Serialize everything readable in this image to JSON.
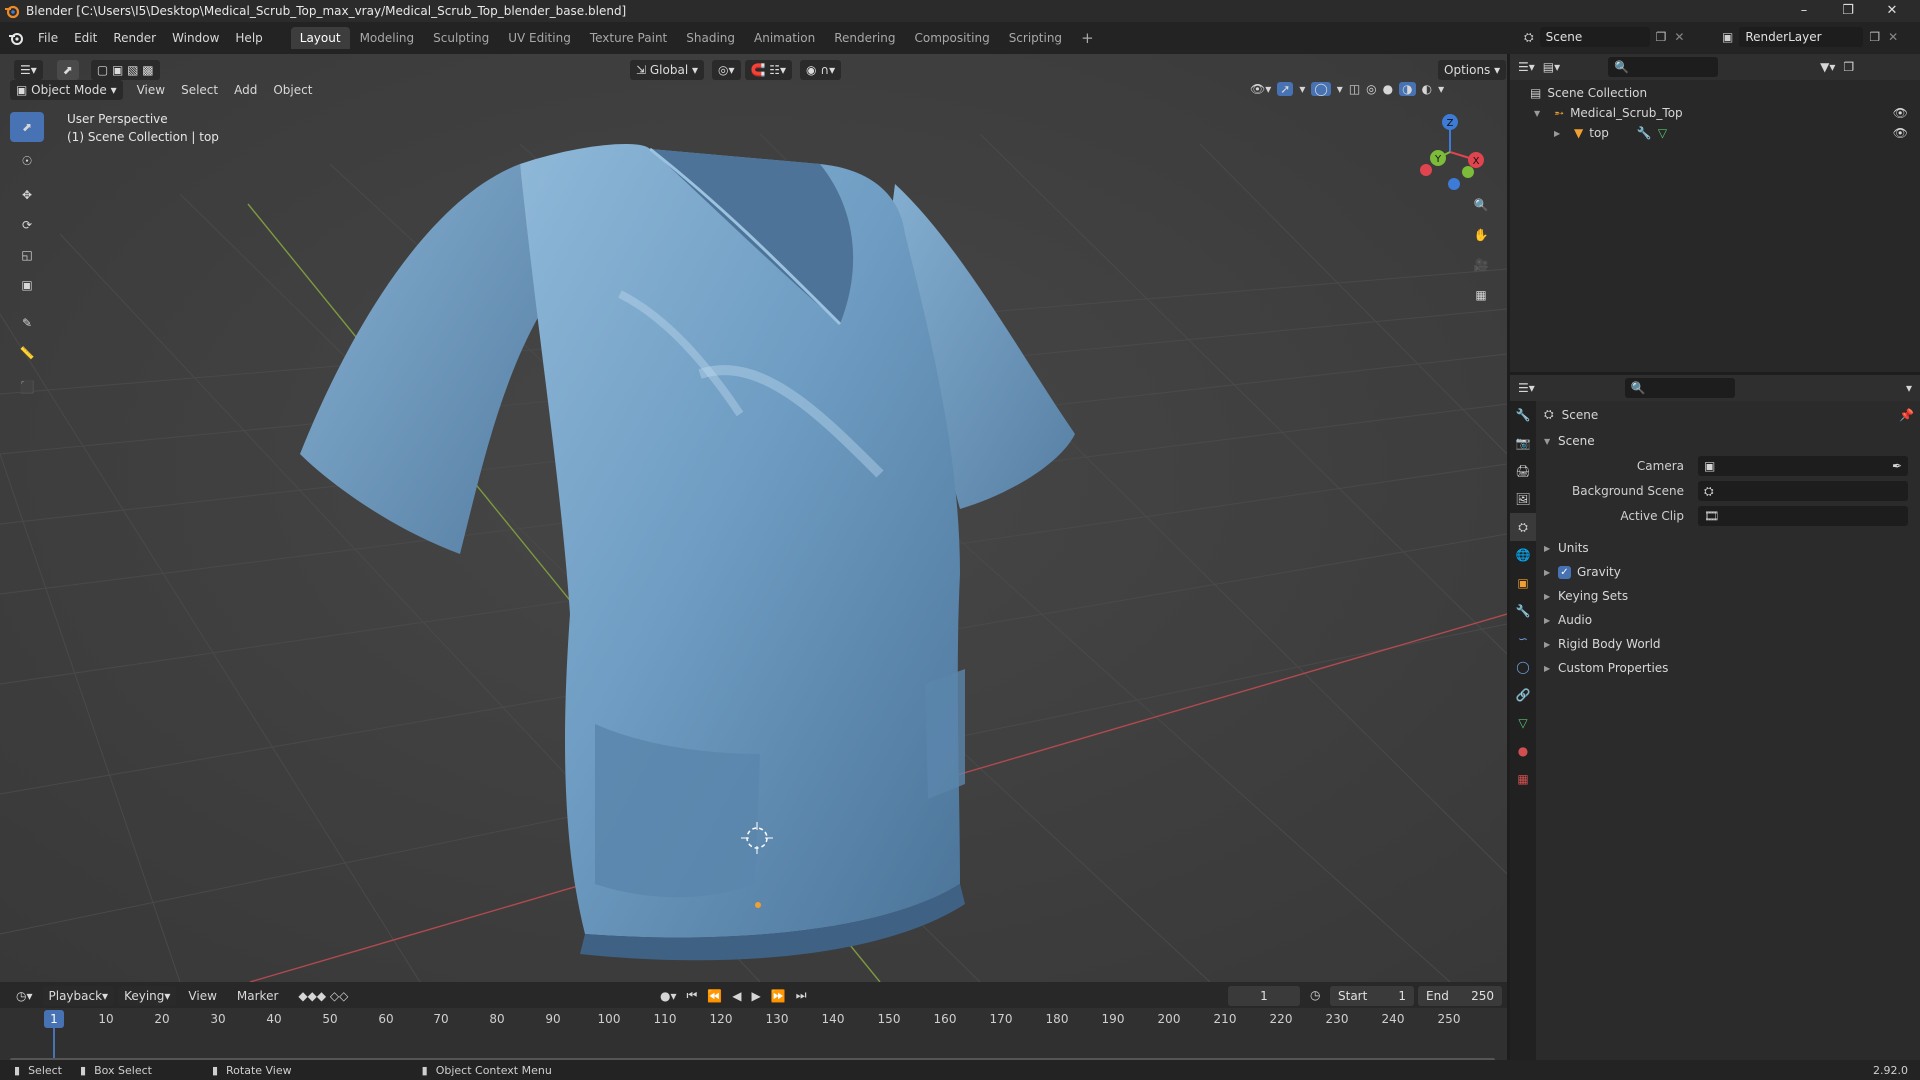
{
  "window": {
    "title": "Blender [C:\\Users\\I5\\Desktop\\Medical_Scrub_Top_max_vray/Medical_Scrub_Top_blender_base.blend]"
  },
  "menu": [
    "File",
    "Edit",
    "Render",
    "Window",
    "Help"
  ],
  "workspaces": [
    "Layout",
    "Modeling",
    "Sculpting",
    "UV Editing",
    "Texture Paint",
    "Shading",
    "Animation",
    "Rendering",
    "Compositing",
    "Scripting"
  ],
  "active_workspace": "Layout",
  "scene_field": "Scene",
  "renderlayer_field": "RenderLayer",
  "viewport": {
    "mode": "Object Mode",
    "menus": [
      "View",
      "Select",
      "Add",
      "Object"
    ],
    "transform_orientation": "Global",
    "options_label": "Options",
    "overlay_line1": "User Perspective",
    "overlay_line2": "(1) Scene Collection | top",
    "gizmo_axes": {
      "x": "X",
      "y": "Y",
      "z": "Z"
    }
  },
  "outliner": {
    "root": "Scene Collection",
    "items": [
      {
        "label": "Medical_Scrub_Top"
      },
      {
        "label": "top"
      }
    ]
  },
  "properties": {
    "header": "Scene",
    "section": "Scene",
    "fields": [
      {
        "label": "Camera"
      },
      {
        "label": "Background Scene"
      },
      {
        "label": "Active Clip"
      }
    ],
    "panels": [
      "Units",
      "Gravity",
      "Keying Sets",
      "Audio",
      "Rigid Body World",
      "Custom Properties"
    ],
    "gravity_checked": true
  },
  "timeline": {
    "menus": [
      "Playback",
      "Keying",
      "View",
      "Marker"
    ],
    "current_frame": "1",
    "start_label": "Start",
    "start_value": "1",
    "end_label": "End",
    "end_value": "250",
    "ruler": [
      "1",
      "10",
      "20",
      "30",
      "40",
      "50",
      "60",
      "70",
      "80",
      "90",
      "100",
      "110",
      "120",
      "130",
      "140",
      "150",
      "160",
      "170",
      "180",
      "190",
      "200",
      "210",
      "220",
      "230",
      "240",
      "250"
    ]
  },
  "statusbar": {
    "select": "Select",
    "box_select": "Box Select",
    "rotate": "Rotate View",
    "context": "Object Context Menu",
    "version": "2.92.0"
  },
  "colors": {
    "accent": "#4772b3",
    "x_axis": "#e0444f",
    "y_axis": "#7dbb3a",
    "z_axis": "#3d7bd6",
    "shirt": "#6f9dc3"
  }
}
